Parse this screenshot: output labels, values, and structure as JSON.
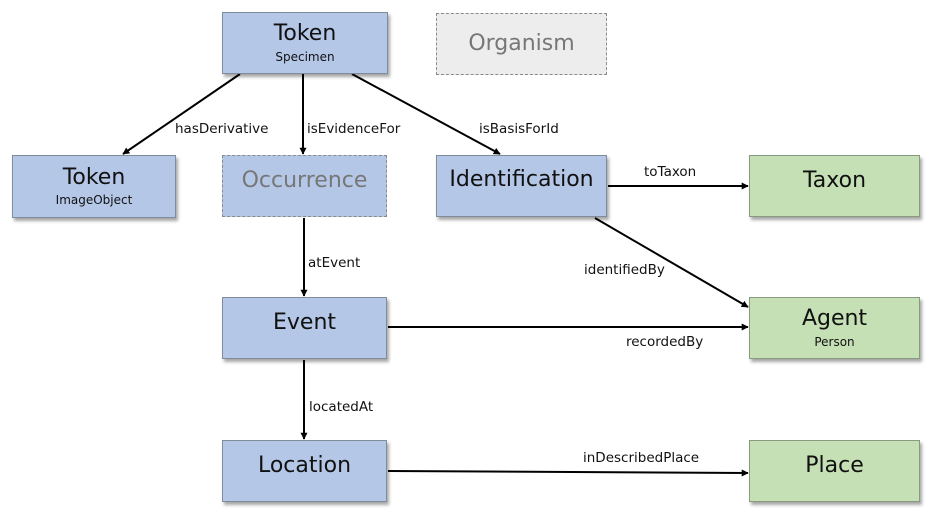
{
  "diagram": {
    "nodes": {
      "token_specimen": {
        "title": "Token",
        "subtitle": "Specimen",
        "color": "#b4c7e7",
        "style": "solid"
      },
      "organism": {
        "title": "Organism",
        "color": "#ededed",
        "style": "dashed"
      },
      "token_imageobject": {
        "title": "Token",
        "subtitle": "ImageObject",
        "color": "#b4c7e7",
        "style": "solid"
      },
      "occurrence": {
        "title": "Occurrence",
        "color": "#b4c7e7",
        "style": "dashed"
      },
      "identification": {
        "title": "Identification",
        "color": "#b4c7e7",
        "style": "solid"
      },
      "taxon": {
        "title": "Taxon",
        "color": "#c5e0b4",
        "style": "solid"
      },
      "event": {
        "title": "Event",
        "color": "#b4c7e7",
        "style": "solid"
      },
      "agent": {
        "title": "Agent",
        "subtitle": "Person",
        "color": "#c5e0b4",
        "style": "solid"
      },
      "location": {
        "title": "Location",
        "color": "#b4c7e7",
        "style": "solid"
      },
      "place": {
        "title": "Place",
        "color": "#c5e0b4",
        "style": "solid"
      }
    },
    "edges": {
      "has_derivative": {
        "label": "hasDerivative",
        "from": "Token (Specimen)",
        "to": "Token (ImageObject)"
      },
      "is_evidence_for": {
        "label": "isEvidenceFor",
        "from": "Token (Specimen)",
        "to": "Occurrence"
      },
      "is_basis_for_id": {
        "label": "isBasisForId",
        "from": "Token (Specimen)",
        "to": "Identification"
      },
      "to_taxon": {
        "label": "toTaxon",
        "from": "Identification",
        "to": "Taxon"
      },
      "identified_by": {
        "label": "identifiedBy",
        "from": "Identification",
        "to": "Agent"
      },
      "at_event": {
        "label": "atEvent",
        "from": "Occurrence",
        "to": "Event"
      },
      "recorded_by": {
        "label": "recordedBy",
        "from": "Event",
        "to": "Agent"
      },
      "located_at": {
        "label": "locatedAt",
        "from": "Event",
        "to": "Location"
      },
      "in_described_place": {
        "label": "inDescribedPlace",
        "from": "Location",
        "to": "Place"
      }
    }
  }
}
